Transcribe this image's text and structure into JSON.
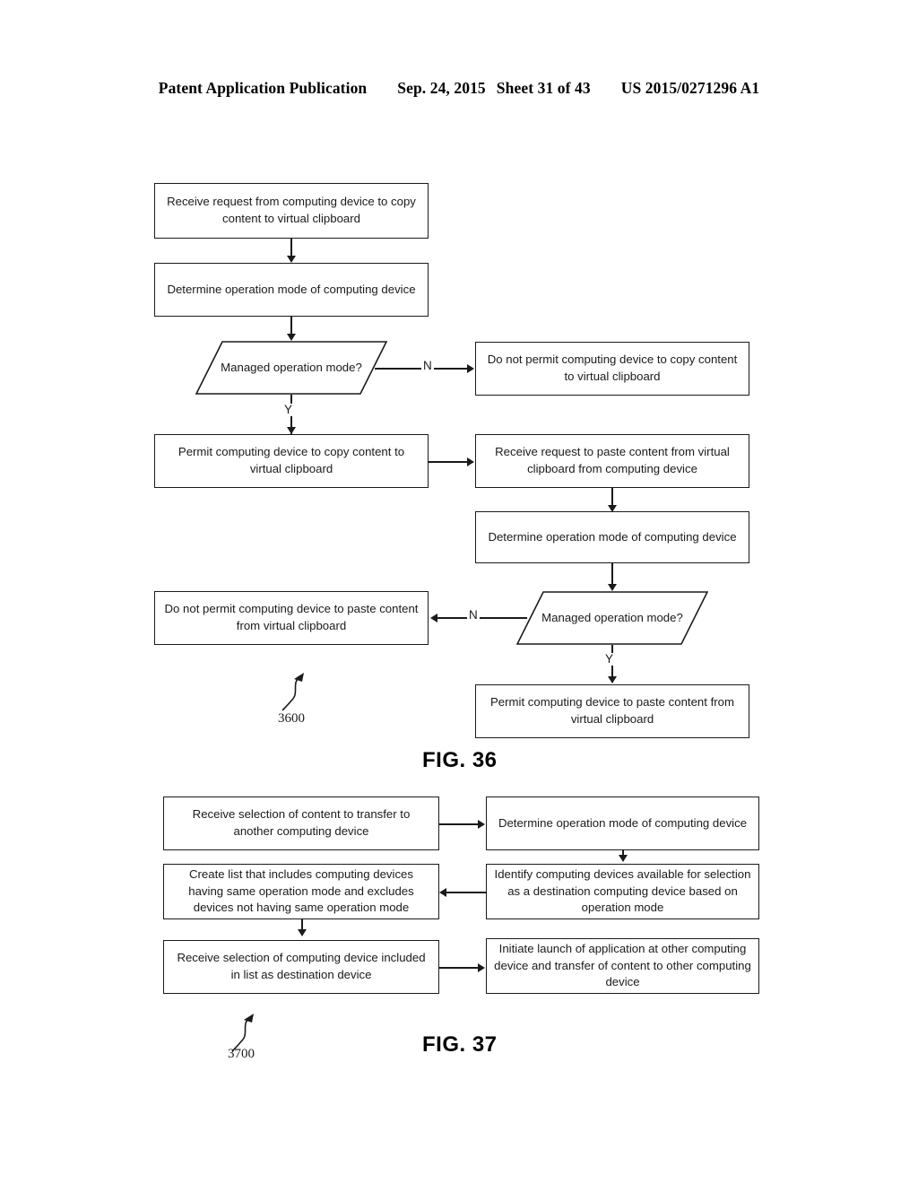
{
  "header": {
    "publication": "Patent Application Publication",
    "date": "Sep. 24, 2015",
    "sheet": "Sheet 31 of 43",
    "pub_number": "US 2015/0271296 A1"
  },
  "figures": [
    {
      "caption": "FIG. 36",
      "reference_numeral": "3600",
      "nodes": {
        "receive_copy_request": "Receive request from computing device to copy content to virtual clipboard",
        "determine_mode_1": "Determine operation mode of computing device",
        "decision_1": "Managed operation mode?",
        "deny_copy": "Do not permit computing device to copy content to virtual clipboard",
        "permit_copy": "Permit computing device to copy content to virtual clipboard",
        "receive_paste_request": "Receive request to paste content from virtual clipboard from computing device",
        "determine_mode_2": "Determine operation mode of computing device",
        "decision_2": "Managed operation mode?",
        "deny_paste": "Do not permit computing device to paste content from virtual clipboard",
        "permit_paste": "Permit computing device to paste content from virtual clipboard"
      },
      "branch_labels": {
        "decision_1_no": "N",
        "decision_1_yes": "Y",
        "decision_2_no": "N",
        "decision_2_yes": "Y"
      }
    },
    {
      "caption": "FIG. 37",
      "reference_numeral": "3700",
      "nodes": {
        "receive_content_selection": "Receive selection of content to transfer to another computing device",
        "determine_mode": "Determine operation mode of computing device",
        "create_list": "Create list that includes computing devices having same operation mode and excludes devices not having same operation mode",
        "identify_devices": "Identify computing devices available for selection as a destination computing device based on operation mode",
        "receive_device_selection": "Receive selection of computing device included in list as destination device",
        "initiate_launch": "Initiate launch of application at other computing device and transfer of content to other computing device"
      }
    }
  ],
  "colors": {
    "ink": "#1a1a1a",
    "paper": "#ffffff"
  }
}
